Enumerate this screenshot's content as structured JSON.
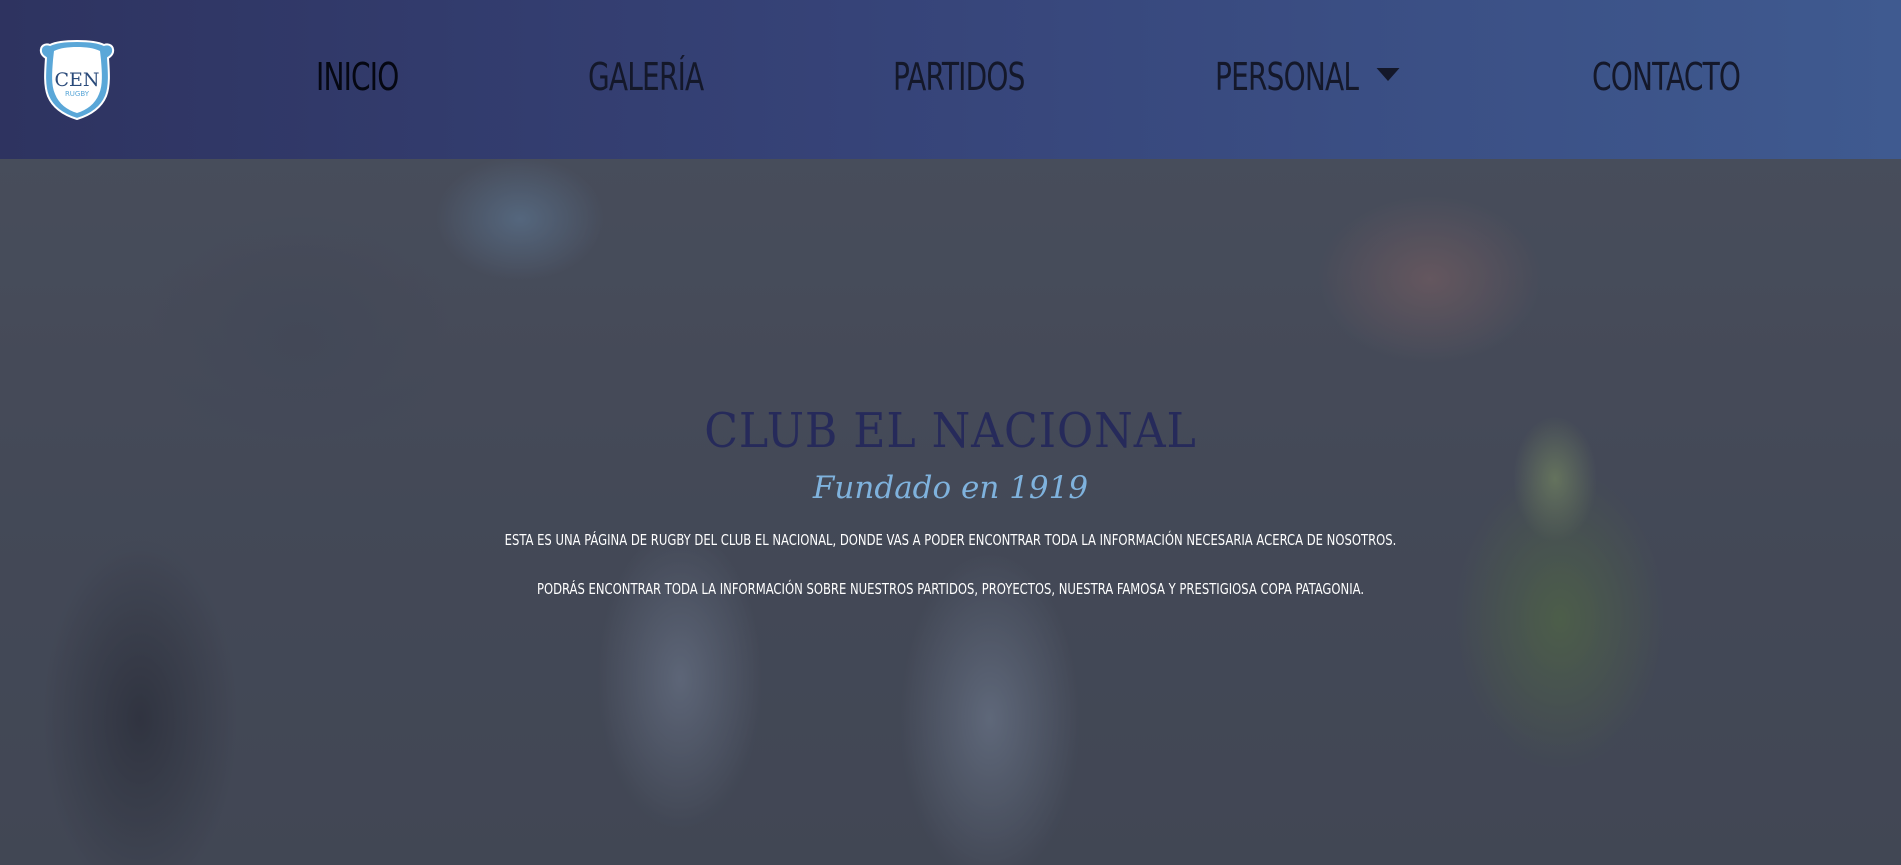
{
  "brand": {
    "logo_text": "CEN",
    "logo_subtext": "RUGBY",
    "colors": {
      "nav_start": "#2e3360",
      "nav_end": "#3f5a90",
      "nav_text": "#14182a",
      "title": "#262a5a",
      "subtitle": "#7fb2dd",
      "logo_blue": "#5aa7d8"
    }
  },
  "nav": {
    "items": [
      {
        "label": "INICIO",
        "active": true
      },
      {
        "label": "GALERÍA"
      },
      {
        "label": "PARTIDOS"
      },
      {
        "label": "PERSONAL",
        "icon": "caret-down-icon"
      },
      {
        "label": "CONTACTO"
      }
    ]
  },
  "hero": {
    "title": "CLUB EL NACIONAL",
    "subtitle": "Fundado en 1919",
    "paragraphs": [
      "Esta es una página de rugby del club El Nacional, donde vas a poder encontrar toda la información necesaria acerca de nosotros.",
      "Podrás encontrar toda la información sobre nuestros partidos, proyectos, nuestra famosa y prestigiosa Copa Patagonia."
    ]
  }
}
